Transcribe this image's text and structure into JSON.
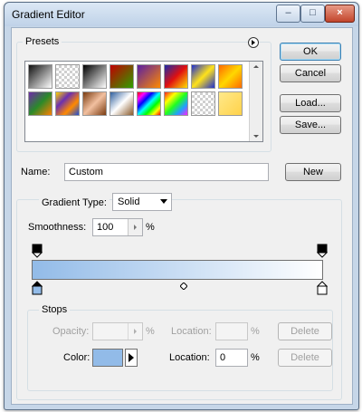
{
  "window": {
    "title": "Gradient Editor",
    "controls": {
      "minimize": "–",
      "maximize": "□",
      "close": "×"
    }
  },
  "presets": {
    "legend": "Presets",
    "menu_icon": "circle-arrow-right-icon",
    "swatches": [
      {
        "name": "black-white",
        "css": "linear-gradient(135deg,#111,#fff)"
      },
      {
        "name": "fg-transparent",
        "css": "chk"
      },
      {
        "name": "black-white-2",
        "css": "linear-gradient(135deg,#000,#fff)"
      },
      {
        "name": "red-green",
        "css": "linear-gradient(135deg,#c00000,#2ea000)"
      },
      {
        "name": "violet-orange",
        "css": "linear-gradient(135deg,#5a1fa2,#ff8a00)"
      },
      {
        "name": "blue-red-yellow",
        "css": "linear-gradient(135deg,#1a2aa8,#e01010,#ffe000)"
      },
      {
        "name": "blue-yellow-blue",
        "css": "linear-gradient(135deg,#1e2fd0,#ffe21a,#1e2fd0)"
      },
      {
        "name": "orange-yellow-orange",
        "css": "linear-gradient(135deg,#ff6a00,#ffd700,#ff6a00)"
      },
      {
        "name": "violet-green-orange",
        "css": "linear-gradient(135deg,#6e2aa8,#2a8a2a,#ff8000)"
      },
      {
        "name": "yellow-violet-orange-blue",
        "css": "linear-gradient(135deg,#ffd400,#6b2fb0,#ff8a00,#1f4ed8)"
      },
      {
        "name": "copper",
        "css": "linear-gradient(135deg,#7a3b10,#f2c0a0,#7a3b10)"
      },
      {
        "name": "chrome",
        "css": "linear-gradient(135deg,#2f5f9e,#ffffff,#8a5a2a)"
      },
      {
        "name": "spectrum",
        "css": "linear-gradient(135deg,#ff0000,#ff00ff,#0000ff,#00ffff,#00ff00,#ffff00,#ff0000)"
      },
      {
        "name": "transparent-rainbow",
        "css": "linear-gradient(135deg,#ff2020,#ffff00,#20ff20,#20a0ff,#ff20ff)"
      },
      {
        "name": "transparent-stripes",
        "css": "chk"
      },
      {
        "name": "yellow-light",
        "css": "linear-gradient(135deg,#ffe98a,#ffd24a)"
      }
    ]
  },
  "buttons": {
    "ok": "OK",
    "cancel": "Cancel",
    "load": "Load...",
    "save": "Save...",
    "new": "New"
  },
  "name_field": {
    "label": "Name:",
    "value": "Custom"
  },
  "gradient": {
    "type_label": "Gradient Type:",
    "type_value": "Solid",
    "smoothness_label": "Smoothness:",
    "smoothness_value": "100",
    "smoothness_unit": "%",
    "start_color": "#92bbe8",
    "end_color": "#ffffff"
  },
  "stops": {
    "legend": "Stops",
    "opacity_label": "Opacity:",
    "opacity_unit": "%",
    "location_label": "Location:",
    "location_unit": "%",
    "delete_label": "Delete",
    "color_label": "Color:",
    "color_value": "#92bbe8",
    "color_location_label": "Location:",
    "color_location_value": "0",
    "color_location_unit": "%",
    "color_delete_label": "Delete"
  }
}
